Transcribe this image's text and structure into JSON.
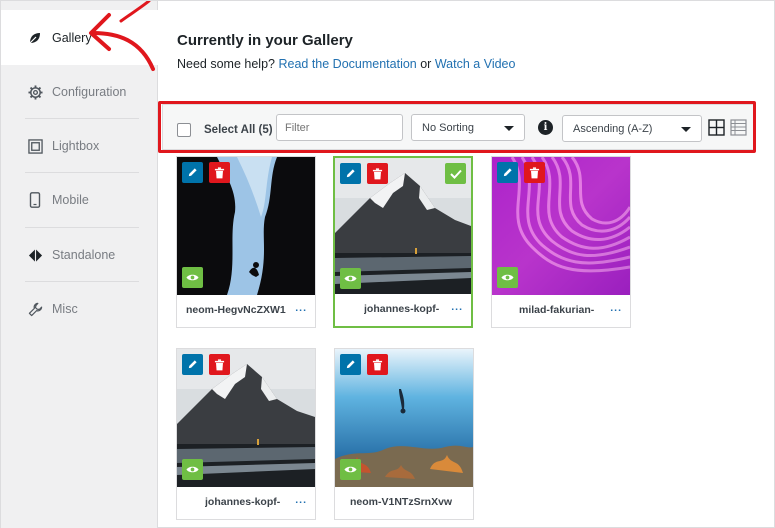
{
  "sidebar": {
    "items": [
      {
        "label": "Gallery",
        "icon": "leaf-icon"
      },
      {
        "label": "Configuration",
        "icon": "gear-icon"
      },
      {
        "label": "Lightbox",
        "icon": "lightbox-icon"
      },
      {
        "label": "Mobile",
        "icon": "mobile-icon"
      },
      {
        "label": "Standalone",
        "icon": "diamond-icon"
      },
      {
        "label": "Misc",
        "icon": "wrench-icon"
      }
    ]
  },
  "header": {
    "title": "Currently in your Gallery",
    "help_prefix": "Need some help?",
    "docs_link": "Read the Documentation",
    "or_text": "or",
    "video_link": "Watch a Video"
  },
  "toolbar": {
    "select_all": "Select All (5)",
    "filter_placeholder": "Filter",
    "sorting": "No Sorting",
    "order": "Ascending (A-Z)",
    "info": "i"
  },
  "images": [
    {
      "name": "neom-HegvNcZXW1",
      "selected": false
    },
    {
      "name": "johannes-kopf-",
      "selected": true
    },
    {
      "name": "milad-fakurian-",
      "selected": false
    },
    {
      "name": "johannes-kopf-",
      "selected": false
    },
    {
      "name": "neom-V1NTzSrnXvw",
      "selected": false
    }
  ],
  "caption_more": "...",
  "colors": {
    "edit": "#0073aa",
    "delete": "#e0171d",
    "view": "#6fbe44",
    "link": "#2271b1",
    "highlight": "#e0171d"
  }
}
